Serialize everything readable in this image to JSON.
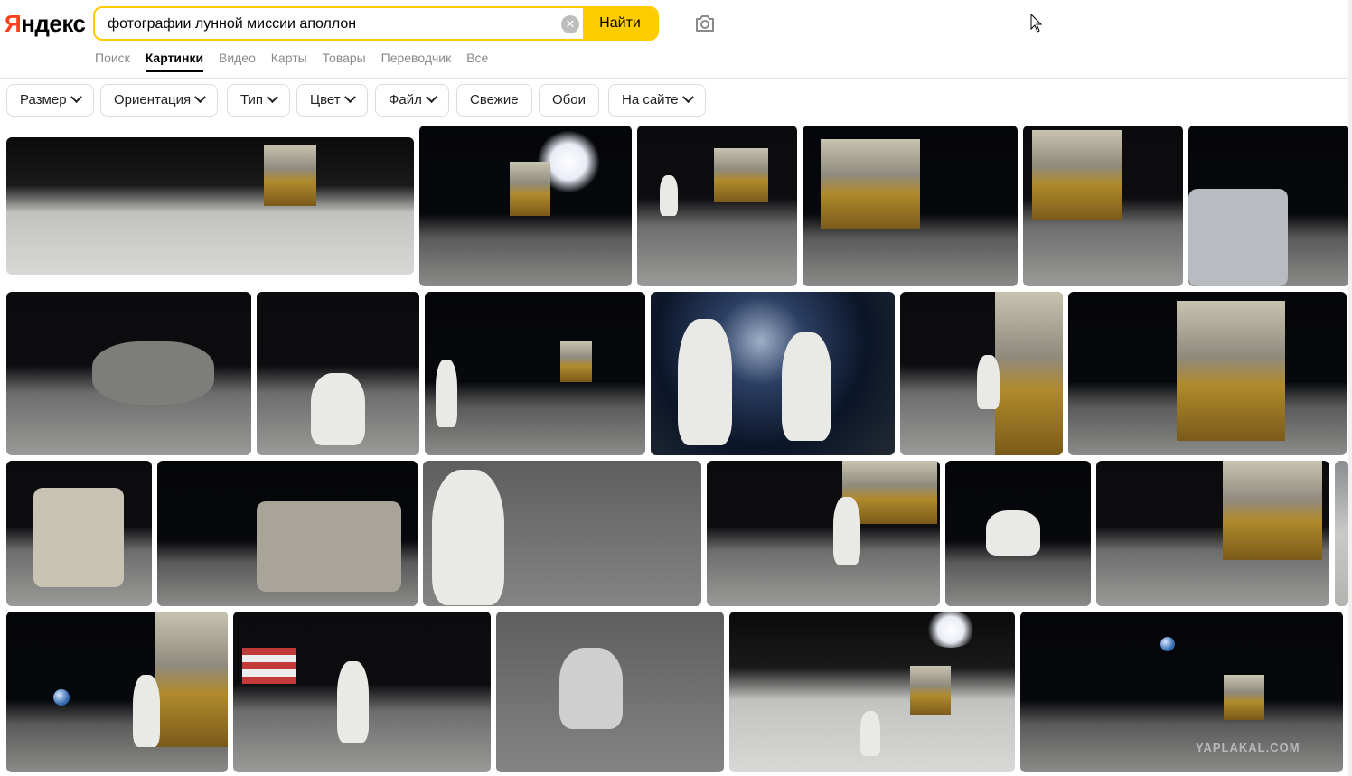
{
  "header": {
    "logo": {
      "ya": "Я",
      "rest": "ндекс"
    },
    "search_value": "фотографии лунной миссии аполлон",
    "find_button": "Найти"
  },
  "tabs": [
    {
      "label": "Поиск"
    },
    {
      "label": "Картинки",
      "active": true
    },
    {
      "label": "Видео"
    },
    {
      "label": "Карты"
    },
    {
      "label": "Товары"
    },
    {
      "label": "Переводчик"
    },
    {
      "label": "Все"
    }
  ],
  "filters": [
    {
      "label": "Размер",
      "dropdown": true
    },
    {
      "label": "Ориентация",
      "dropdown": true
    },
    {
      "label": "Тип",
      "dropdown": true
    },
    {
      "label": "Цвет",
      "dropdown": true
    },
    {
      "label": "Файл",
      "dropdown": true
    },
    {
      "label": "Свежие",
      "dropdown": false
    },
    {
      "label": "Обои",
      "dropdown": false
    },
    {
      "label": "На сайте",
      "dropdown": true
    }
  ],
  "results_watermark": "YAPLAKAL.COM",
  "colors": {
    "brand_yellow": "#ffcc00",
    "logo_red": "#fc3f1d"
  }
}
